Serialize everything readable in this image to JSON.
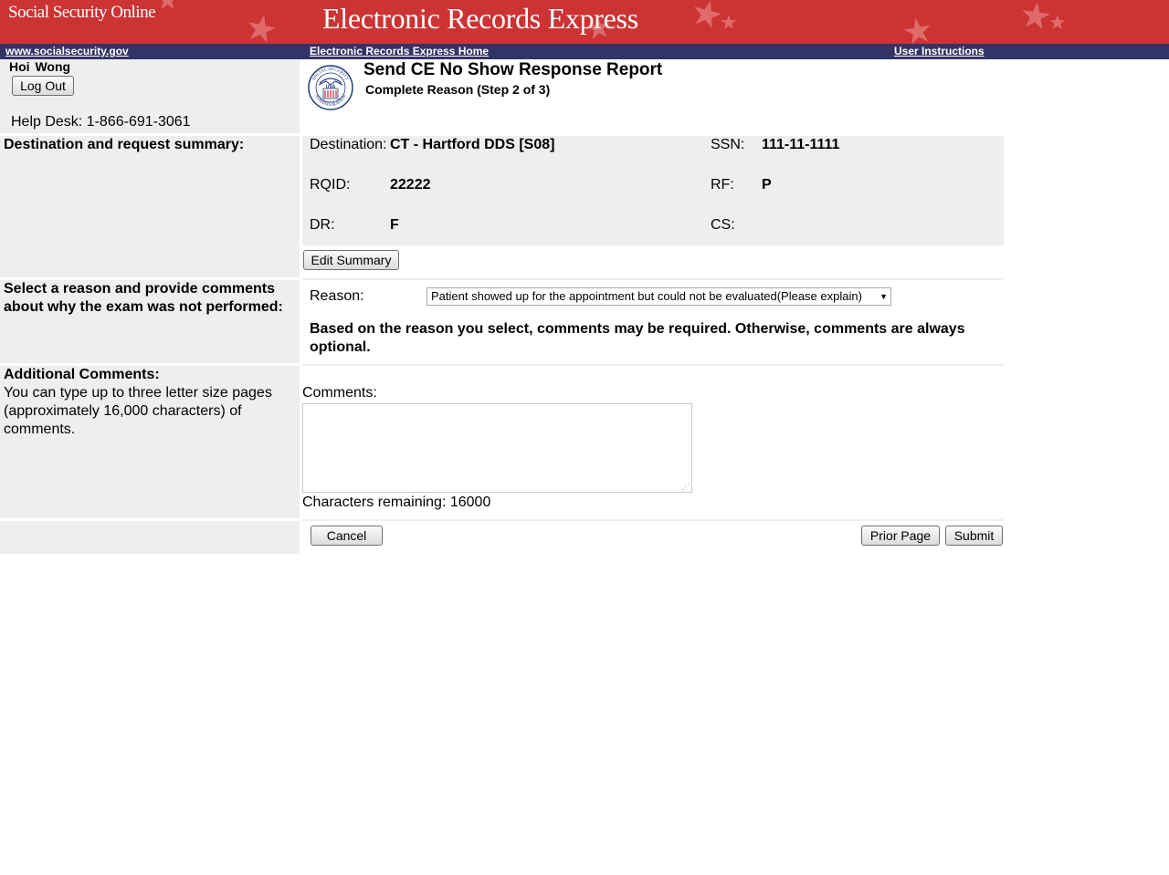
{
  "header": {
    "site_name": "Social Security Online",
    "app_title": "Electronic Records Express"
  },
  "nav": {
    "ssa_link": "www.socialsecurity.gov",
    "home_link": "Electronic Records Express Home",
    "instructions_link": "User Instructions"
  },
  "user": {
    "name": "Hoi  Wong",
    "logout_label": "Log Out",
    "help_desk": "Help Desk: 1-866-691-3061"
  },
  "logo": {
    "text_top": "SOCIAL SECURITY",
    "text_bottom": "ADMINISTRATION",
    "center": "USA"
  },
  "page": {
    "title": "Send CE No Show Response Report",
    "subtitle": "Complete Reason (Step 2 of 3)"
  },
  "summary": {
    "section_label": "Destination and request summary:",
    "destination_label": "Destination:",
    "destination_value": "CT - Hartford DDS [S08]",
    "ssn_label": "SSN:",
    "ssn_value": "111-11-1111",
    "rqid_label": "RQID:",
    "rqid_value": "22222",
    "rf_label": "RF:",
    "rf_value": "P",
    "dr_label": "DR:",
    "dr_value": "F",
    "cs_label": "CS:",
    "cs_value": "",
    "edit_button": "Edit Summary"
  },
  "reason": {
    "section_label": "Select a reason and provide comments about why the exam was not performed:",
    "label": "Reason:",
    "selected": "Patient showed up for the appointment but could not be evaluated(Please explain)",
    "note": "Based on the reason you select, comments may be required. Otherwise, comments are always optional."
  },
  "comments": {
    "section_title": "Additional Comments:",
    "section_desc": "You can type up to three letter size pages (approximately 16,000 characters) of comments.",
    "label": "Comments:",
    "value": "",
    "remaining": "Characters remaining: 16000"
  },
  "actions": {
    "cancel": "Cancel",
    "prior_page": "Prior Page",
    "submit": "Submit"
  },
  "colors": {
    "banner_red": "#cc3333",
    "nav_navy": "#333366",
    "panel_grey": "#eeeeee"
  }
}
